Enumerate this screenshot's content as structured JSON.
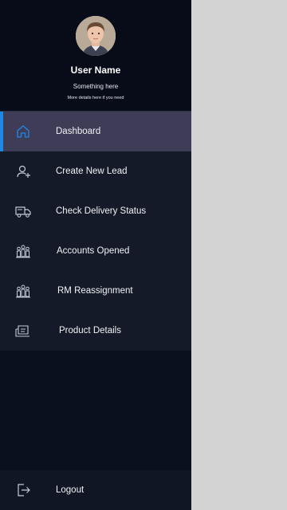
{
  "profile": {
    "name": "User Name",
    "subtitle": "Something here",
    "details": "More details here if you need"
  },
  "menu": {
    "items": [
      {
        "label": "Dashboard",
        "icon": "home-icon",
        "active": true
      },
      {
        "label": "Create New Lead",
        "icon": "add-user-icon",
        "active": false
      },
      {
        "label": "Check Delivery Status",
        "icon": "delivery-truck-icon",
        "active": false
      },
      {
        "label": "Accounts Opened",
        "icon": "people-group-icon",
        "active": false
      },
      {
        "label": "RM Reassignment",
        "icon": "people-group-icon",
        "active": false
      },
      {
        "label": "Product Details",
        "icon": "product-box-icon",
        "active": false
      }
    ]
  },
  "logout": {
    "label": "Logout",
    "icon": "logout-icon"
  },
  "colors": {
    "drawer_bg": "#0a101e",
    "menu_bg": "#151a28",
    "active_bg": "#3f3c58",
    "active_accent": "#1e88e5",
    "overlay": "#d3d3d3"
  }
}
